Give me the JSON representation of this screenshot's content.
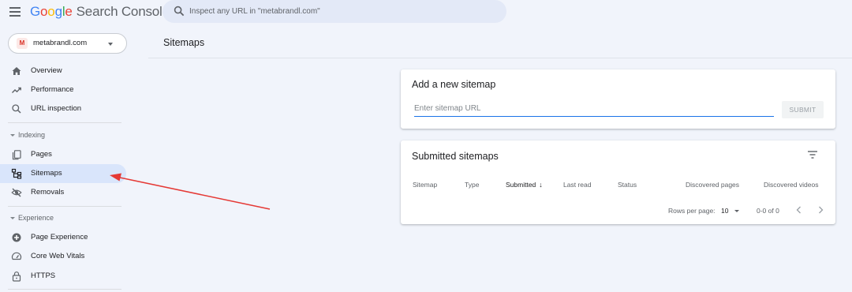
{
  "app": {
    "logo_letters": [
      "G",
      "o",
      "o",
      "g",
      "l",
      "e"
    ],
    "product": "Search Console"
  },
  "search": {
    "placeholder": "Inspect any URL in \"metabrandl.com\""
  },
  "property": {
    "badge": "M",
    "name": "metabrandl.com"
  },
  "sidebar": {
    "items": [
      {
        "label": "Overview",
        "icon": "home-icon"
      },
      {
        "label": "Performance",
        "icon": "trending-up-icon"
      },
      {
        "label": "URL inspection",
        "icon": "search-icon"
      }
    ],
    "sections": [
      {
        "title": "Indexing",
        "items": [
          {
            "label": "Pages",
            "icon": "pages-icon"
          },
          {
            "label": "Sitemaps",
            "icon": "sitemap-icon",
            "active": true
          },
          {
            "label": "Removals",
            "icon": "removals-icon"
          }
        ]
      },
      {
        "title": "Experience",
        "items": [
          {
            "label": "Page Experience",
            "icon": "page-experience-icon"
          },
          {
            "label": "Core Web Vitals",
            "icon": "speedometer-icon"
          },
          {
            "label": "HTTPS",
            "icon": "lock-icon"
          }
        ]
      }
    ]
  },
  "main": {
    "page_title": "Sitemaps",
    "add_sitemap": {
      "title": "Add a new sitemap",
      "input_placeholder": "Enter sitemap URL",
      "submit_label": "SUBMIT"
    },
    "submitted": {
      "title": "Submitted sitemaps",
      "columns": [
        "Sitemap",
        "Type",
        "Submitted",
        "Last read",
        "Status",
        "Discovered pages",
        "Discovered videos"
      ],
      "sorted_column": "Submitted",
      "sort_direction": "descending",
      "rows": [],
      "pagination": {
        "rows_per_page_label": "Rows per page:",
        "rows_per_page": "10",
        "range": "0-0 of 0"
      }
    }
  },
  "colors": {
    "background": "#f1f4fb",
    "accent": "#1a73e8",
    "active_nav": "#d9e5fb",
    "annotation_arrow": "#e53935"
  }
}
